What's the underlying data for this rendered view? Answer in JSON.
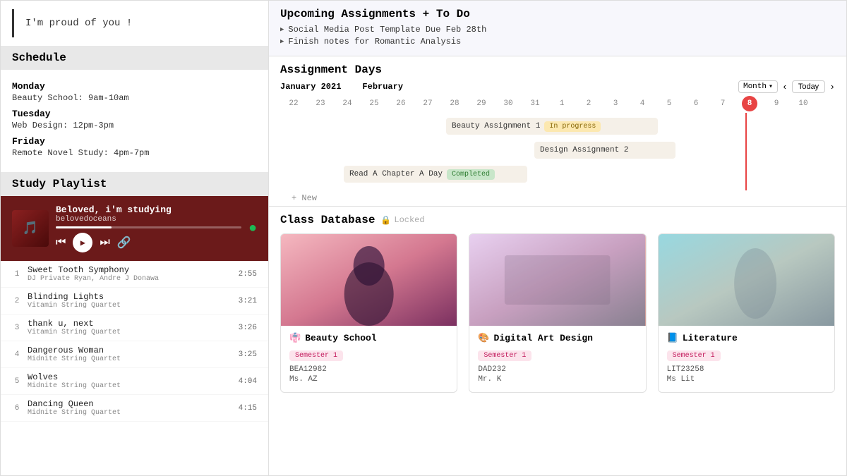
{
  "left": {
    "quote": "I'm proud of you !",
    "schedule_title": "Schedule",
    "days": [
      {
        "day": "Monday",
        "item": "Beauty School: 9am-10am"
      },
      {
        "day": "Tuesday",
        "item": "Web Design: 12pm-3pm"
      },
      {
        "day": "Friday",
        "item": "Remote Novel Study: 4pm-7pm"
      }
    ],
    "playlist_title": "Study Playlist",
    "player": {
      "song_title": "Beloved, i'm studying",
      "artist": "belovedoceans"
    },
    "tracks": [
      {
        "num": "1",
        "name": "Sweet Tooth Symphony",
        "artist": "DJ Private Ryan, Andre J Donawa",
        "duration": "2:55"
      },
      {
        "num": "2",
        "name": "Blinding Lights",
        "artist": "Vitamin String Quartet",
        "duration": "3:21"
      },
      {
        "num": "3",
        "name": "thank u, next",
        "artist": "Vitamin String Quartet",
        "duration": "3:26"
      },
      {
        "num": "4",
        "name": "Dangerous Woman",
        "artist": "Midnite String Quartet",
        "duration": "3:25"
      },
      {
        "num": "5",
        "name": "Wolves",
        "artist": "Midnite String Quartet",
        "duration": "4:04"
      },
      {
        "num": "6",
        "name": "Dancing Queen",
        "artist": "Midnite String Quartet",
        "duration": "4:15"
      }
    ]
  },
  "right": {
    "upcoming_title": "Upcoming Assignments + To Do",
    "upcoming_items": [
      "Social Media Post Template Due Feb 28th",
      "Finish notes for Romantic Analysis"
    ],
    "assignment_days_title": "Assignment Days",
    "calendar": {
      "months": [
        "January 2021",
        "February"
      ],
      "month_btn": "Month",
      "today_btn": "Today",
      "dates": [
        "22",
        "23",
        "24",
        "25",
        "26",
        "27",
        "28",
        "29",
        "30",
        "31",
        "1",
        "2",
        "3",
        "4",
        "5",
        "6",
        "7",
        "8",
        "9",
        "10"
      ],
      "today_date": "8"
    },
    "gantt_bars": [
      {
        "label": "Beauty Assignment 1",
        "badge": "In progress",
        "badge_type": "in-progress"
      },
      {
        "label": "Design Assignment 2",
        "badge": "",
        "badge_type": ""
      },
      {
        "label": "Read A Chapter A Day",
        "badge": "Completed",
        "badge_type": "completed"
      }
    ],
    "new_label": "+ New",
    "class_db_title": "Class Database",
    "lock_label": "🔒 Locked",
    "classes": [
      {
        "icon": "👘",
        "title": "Beauty School",
        "semester": "Semester 1",
        "code": "BEA12982",
        "teacher": "Ms. AZ",
        "img_class": "card-img-beauty"
      },
      {
        "icon": "🎨",
        "title": "Digital Art Design",
        "semester": "Semester 1",
        "code": "DAD232",
        "teacher": "Mr. K",
        "img_class": "card-img-design"
      },
      {
        "icon": "📘",
        "title": "Literature",
        "semester": "Semester 1",
        "code": "LIT23258",
        "teacher": "Ms Lit",
        "img_class": "card-img-lit"
      }
    ]
  }
}
